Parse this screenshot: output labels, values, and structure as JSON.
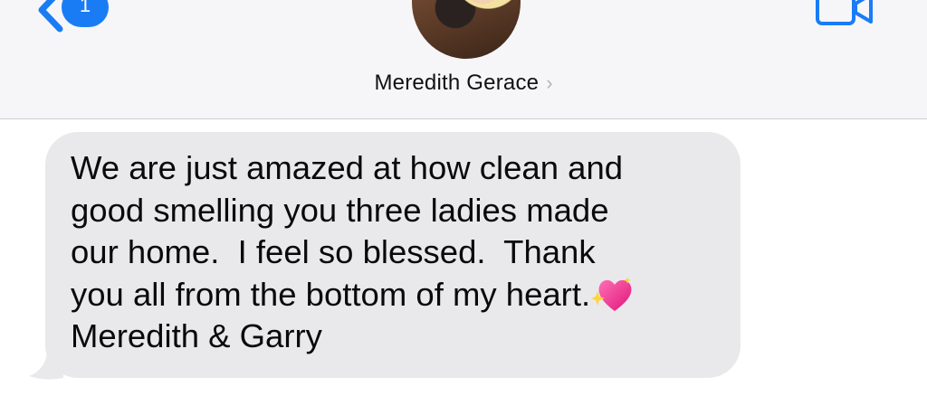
{
  "header": {
    "back_badge_count": "1",
    "contact_name": "Meredith Gerace",
    "contact_chevron": "›"
  },
  "message": {
    "lines": [
      "We are just amazed at how clean and",
      "good smelling you three ladies made",
      "our home.  I feel so blessed.  Thank",
      "you all from the bottom of my heart.",
      "Meredith & Garry"
    ],
    "emoji": "sparkling-heart"
  },
  "colors": {
    "accent": "#1a7cf5",
    "bubble": "#e9e9eb",
    "header_bg": "#f6f6f8"
  },
  "icons": [
    "back-chevron-icon",
    "facetime-video-icon",
    "sparkling-heart-icon"
  ]
}
